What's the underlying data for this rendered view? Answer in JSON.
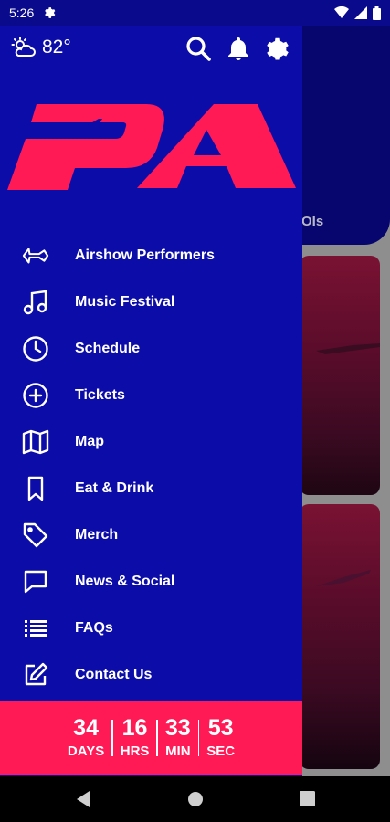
{
  "status_bar": {
    "time": "5:26"
  },
  "background_app": {
    "hero_label_partial": "OIs"
  },
  "drawer": {
    "weather": {
      "temperature": "82°",
      "icon": "partly-sunny-icon"
    },
    "logo": {
      "text": "PA"
    },
    "menu": [
      {
        "label": "Airshow Performers",
        "icon": "jet-icon"
      },
      {
        "label": "Music Festival",
        "icon": "music-note-icon"
      },
      {
        "label": "Schedule",
        "icon": "clock-icon"
      },
      {
        "label": "Tickets",
        "icon": "plus-circle-icon"
      },
      {
        "label": "Map",
        "icon": "map-icon"
      },
      {
        "label": "Eat & Drink",
        "icon": "bookmark-icon"
      },
      {
        "label": "Merch",
        "icon": "tag-icon"
      },
      {
        "label": "News & Social",
        "icon": "chat-icon"
      },
      {
        "label": "FAQs",
        "icon": "list-icon"
      },
      {
        "label": "Contact Us",
        "icon": "edit-icon"
      }
    ],
    "countdown": {
      "days": {
        "value": "34",
        "label": "DAYS"
      },
      "hours": {
        "value": "16",
        "label": "HRS"
      },
      "minutes": {
        "value": "33",
        "label": "MIN"
      },
      "seconds": {
        "value": "53",
        "label": "SEC"
      }
    }
  },
  "colors": {
    "drawer_bg": "#0c0ca8",
    "accent": "#ff1a56"
  }
}
